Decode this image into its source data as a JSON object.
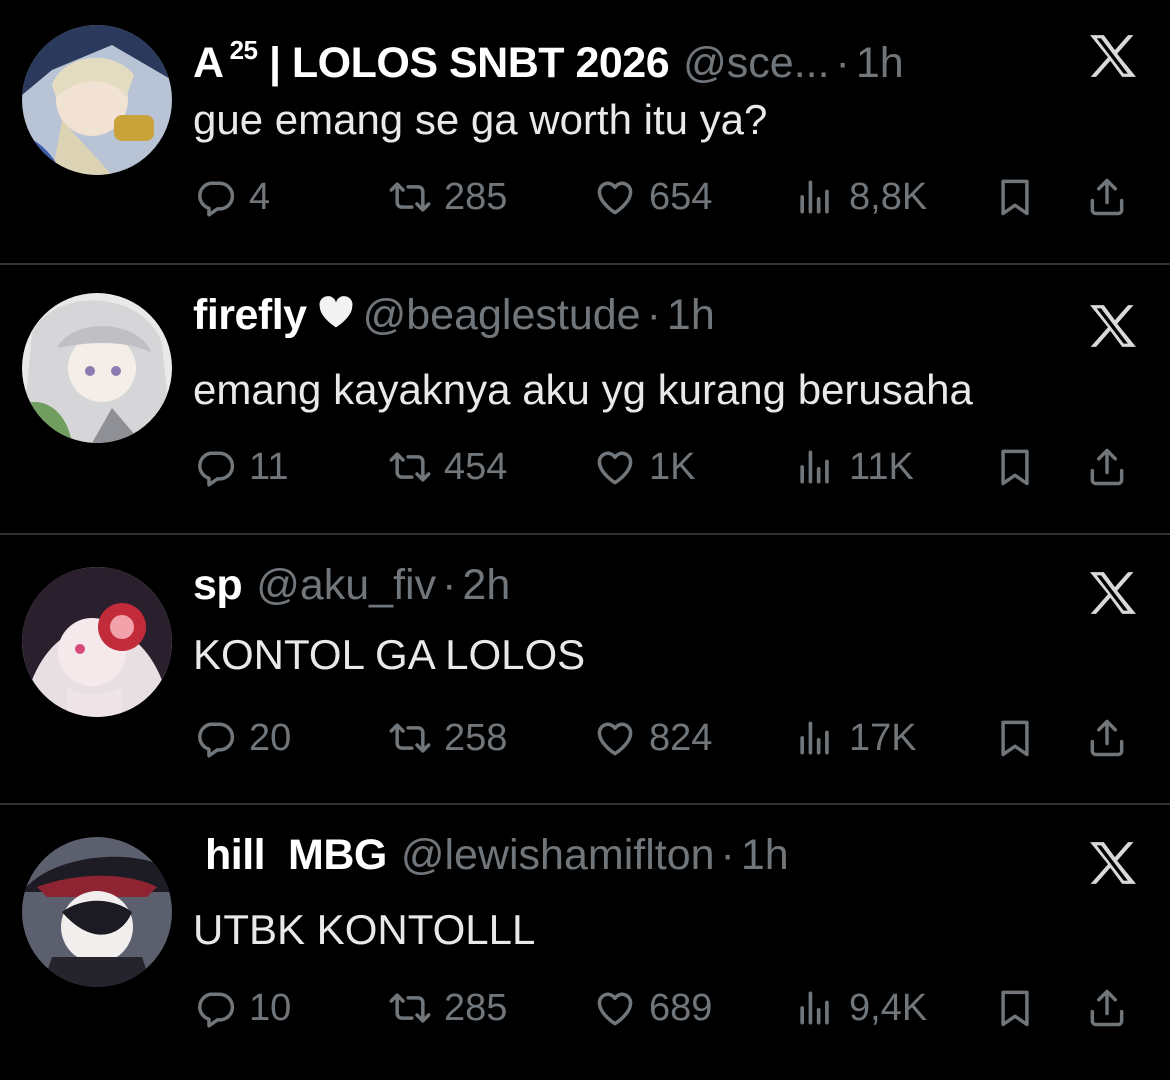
{
  "tweets": [
    {
      "name": "A",
      "name_sup": "25",
      "name_rest": "| LOLOS SNBT 2026",
      "handle": "@sce...",
      "dot": "·",
      "time": "1h",
      "text": "gue emang se ga worth itu ya?",
      "replies": "4",
      "retweets": "285",
      "likes": "654",
      "views": "8,8K"
    },
    {
      "name": "firefly",
      "name_emoji": "white-heart-icon",
      "handle": "@beaglestude",
      "dot": "·",
      "time": "1h",
      "text": "emang kayaknya aku yg kurang berusaha",
      "replies": "11",
      "retweets": "454",
      "likes": "1K",
      "views": "11K"
    },
    {
      "name": "sp",
      "handle": "@aku_fiv",
      "dot": "·",
      "time": "2h",
      "text": "KONTOL GA LOLOS",
      "replies": "20",
      "retweets": "258",
      "likes": "824",
      "views": "17K"
    },
    {
      "name": "hill  MBG",
      "handle": "@lewishamiflton",
      "dot": "·",
      "time": "1h",
      "text": "UTBK KONTOLLL",
      "replies": "10",
      "retweets": "285",
      "likes": "689",
      "views": "9,4K"
    }
  ],
  "colors": {
    "background": "#000000",
    "text": "#e7e9ea",
    "muted": "#71767b",
    "divider": "#2f3336"
  },
  "icons": [
    "x-logo-icon",
    "reply-icon",
    "retweet-icon",
    "like-icon",
    "views-icon",
    "bookmark-icon",
    "share-icon",
    "white-heart-icon"
  ]
}
